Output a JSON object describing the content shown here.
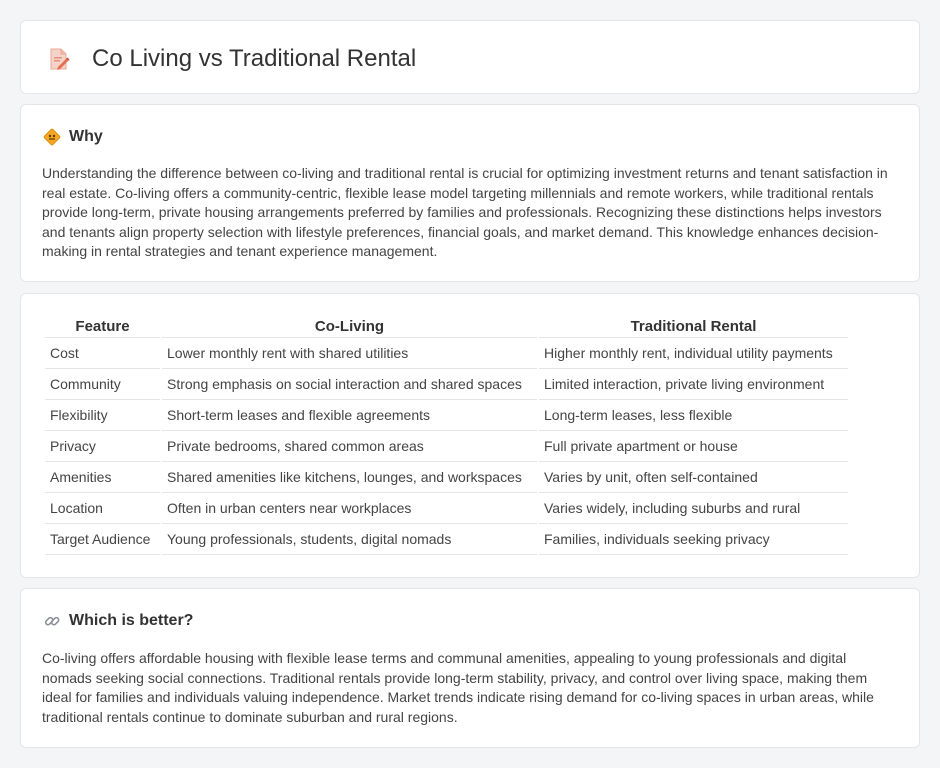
{
  "header": {
    "title": "Co Living vs Traditional Rental",
    "icon": "document-edit-icon"
  },
  "why": {
    "title": "Why",
    "icon": "road-sign-icon",
    "body": "Understanding the difference between co-living and traditional rental is crucial for optimizing investment returns and tenant satisfaction in real estate. Co-living offers a community-centric, flexible lease model targeting millennials and remote workers, while traditional rentals provide long-term, private housing arrangements preferred by families and professionals. Recognizing these distinctions helps investors and tenants align property selection with lifestyle preferences, financial goals, and market demand. This knowledge enhances decision-making in rental strategies and tenant experience management."
  },
  "table": {
    "headers": [
      "Feature",
      "Co-Living",
      "Traditional Rental"
    ],
    "rows": [
      [
        "Cost",
        "Lower monthly rent with shared utilities",
        "Higher monthly rent, individual utility payments"
      ],
      [
        "Community",
        "Strong emphasis on social interaction and shared spaces",
        "Limited interaction, private living environment"
      ],
      [
        "Flexibility",
        "Short-term leases and flexible agreements",
        "Long-term leases, less flexible"
      ],
      [
        "Privacy",
        "Private bedrooms, shared common areas",
        "Full private apartment or house"
      ],
      [
        "Amenities",
        "Shared amenities like kitchens, lounges, and workspaces",
        "Varies by unit, often self-contained"
      ],
      [
        "Location",
        "Often in urban centers near workplaces",
        "Varies widely, including suburbs and rural"
      ],
      [
        "Target Audience",
        "Young professionals, students, digital nomads",
        "Families, individuals seeking privacy"
      ]
    ]
  },
  "better": {
    "title": "Which is better?",
    "icon": "link-icon",
    "body": "Co-living offers affordable housing with flexible lease terms and communal amenities, appealing to young professionals and digital nomads seeking social connections. Traditional rentals provide long-term stability, privacy, and control over living space, making them ideal for families and individuals valuing independence. Market trends indicate rising demand for co-living spaces in urban areas, while traditional rentals continue to dominate suburban and rural regions."
  }
}
